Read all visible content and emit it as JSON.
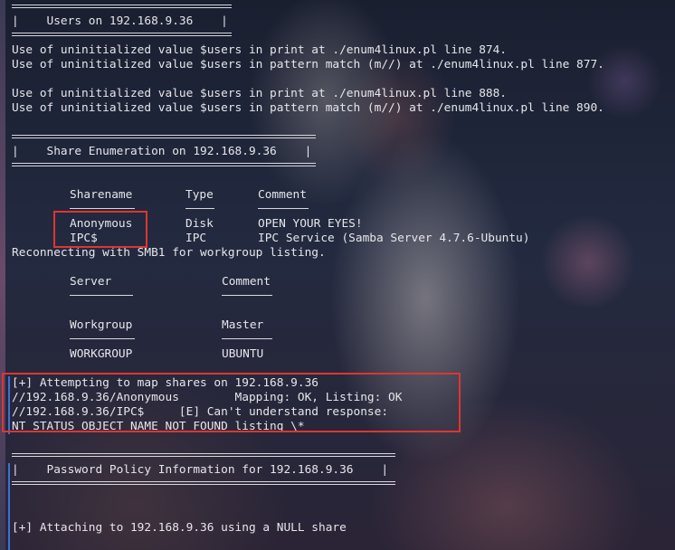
{
  "users_section": {
    "header": "|    Users on 192.168.9.36    |",
    "lines": [
      "Use of uninitialized value $users in print at ./enum4linux.pl line 874.",
      "Use of uninitialized value $users in pattern match (m//) at ./enum4linux.pl line 877.",
      "",
      "Use of uninitialized value $users in print at ./enum4linux.pl line 888.",
      "Use of uninitialized value $users in pattern match (m//) at ./enum4linux.pl line 890."
    ]
  },
  "share_section": {
    "header": "|    Share Enumeration on 192.168.9.36    |",
    "columns": [
      "Sharename",
      "Type",
      "Comment"
    ],
    "rows": [
      {
        "name": "Anonymous",
        "type": "Disk",
        "comment": "OPEN YOUR EYES!"
      },
      {
        "name": "IPC$",
        "type": "IPC",
        "comment": "IPC Service (Samba Server 4.7.6-Ubuntu)"
      }
    ],
    "reconnect": "Reconnecting with SMB1 for workgroup listing.",
    "server_cols": [
      "Server",
      "Comment"
    ],
    "workgroup_cols": [
      "Workgroup",
      "Master"
    ],
    "workgroup_row": [
      "WORKGROUP",
      "UBUNTU"
    ]
  },
  "mapping": {
    "lines": [
      "[+] Attempting to map shares on 192.168.9.36",
      "//192.168.9.36/Anonymous        Mapping: OK, Listing: OK",
      "//192.168.9.36/IPC$     [E] Can't understand response:",
      "NT_STATUS_OBJECT_NAME_NOT_FOUND listing \\*"
    ]
  },
  "password_section": {
    "header": "|    Password Policy Information for 192.168.9.36    |",
    "attach": "[+] Attaching to 192.168.9.36 using a NULL share"
  },
  "colors": {
    "text": "#e6e6ea",
    "highlight_box": "#e0352f",
    "accent": "#3d6fd6"
  }
}
